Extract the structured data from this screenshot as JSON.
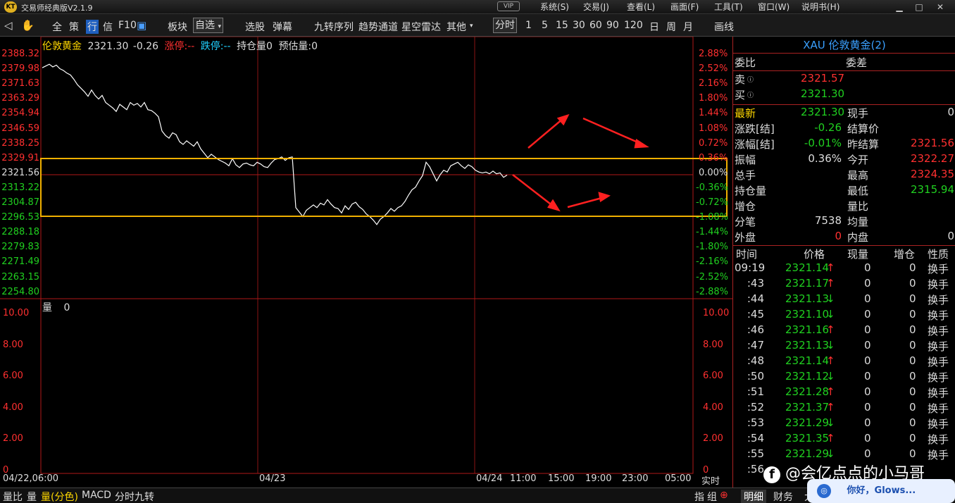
{
  "window": {
    "app_title": "交易师经典版V2.1.9",
    "vip": "VIP",
    "menu": [
      "系统(S)",
      "交易(J)",
      "查看(L)",
      "画面(F)",
      "工具(T)",
      "窗口(W)",
      "说明书(H)"
    ]
  },
  "toolbar": {
    "items": [
      "全",
      "策",
      "行",
      "信",
      "F10",
      "板块",
      "自选",
      "选股",
      "弹幕",
      "九转序列",
      "趋势通道",
      "星空雷达",
      "其他",
      "分时",
      "1",
      "5",
      "15",
      "30",
      "60",
      "90",
      "120",
      "日",
      "周",
      "月",
      "画线"
    ]
  },
  "chart_header": {
    "name": "伦敦黄金",
    "price": "2321.30",
    "change": "-0.26",
    "limit_up": "涨停:--",
    "limit_down": "跌停:--",
    "open_interest": "持仓量0",
    "est_volume": "预估量:0"
  },
  "price_axis": [
    "2388.32",
    "2379.98",
    "2371.63",
    "2363.29",
    "2354.94",
    "2346.59",
    "2338.25",
    "2329.91",
    "2321.56",
    "2313.22",
    "2304.87",
    "2296.53",
    "2288.18",
    "2279.83",
    "2271.49",
    "2263.15",
    "2254.80"
  ],
  "pct_axis": [
    "2.88%",
    "2.52%",
    "2.16%",
    "1.80%",
    "1.44%",
    "1.08%",
    "0.72%",
    "0.36%",
    "0.00%",
    "-0.36%",
    "-0.72%",
    "-1.08%",
    "-1.44%",
    "-1.80%",
    "-2.16%",
    "-2.52%",
    "-2.88%"
  ],
  "vol_header": {
    "label": "量",
    "value": "0"
  },
  "vol_axis": [
    "10.00",
    "8.00",
    "6.00",
    "4.00",
    "2.00",
    "0"
  ],
  "time_axis": {
    "labels": [
      "04/22,06:00",
      "04/23",
      "04/24",
      "11:00",
      "15:00",
      "19:00",
      "23:00",
      "05:00"
    ],
    "realtime": "实时"
  },
  "chart_data": {
    "type": "line",
    "ylim": [
      2254.8,
      2388.32
    ],
    "reference_price": 2321.56,
    "x": [
      0,
      5,
      10,
      15,
      20,
      25,
      30,
      35,
      40,
      45,
      50,
      55,
      60,
      65,
      70,
      75,
      80,
      85,
      90,
      95,
      100,
      105,
      110,
      115,
      120,
      125,
      130,
      135,
      140,
      145,
      150,
      155,
      160,
      165,
      170,
      175,
      180,
      185,
      190,
      195,
      200,
      205,
      210,
      215,
      220,
      225,
      230,
      235,
      240,
      245,
      250,
      255,
      260,
      265,
      270,
      275,
      280,
      285,
      290,
      295,
      300,
      305,
      310,
      315,
      320,
      325,
      330,
      335,
      340,
      345,
      350,
      355,
      360,
      365,
      370,
      375,
      380,
      385,
      390,
      395,
      400,
      405,
      410,
      415,
      420,
      425,
      430,
      435,
      440,
      445,
      450,
      455,
      460,
      465,
      470,
      475,
      480,
      485,
      490,
      495,
      500,
      505,
      510,
      515,
      520,
      525,
      530,
      535,
      540,
      545,
      550,
      555,
      560,
      565,
      570,
      575,
      580,
      585,
      590,
      595,
      600,
      605,
      610,
      615,
      620,
      625,
      630,
      635,
      640,
      645,
      650,
      655,
      660
    ],
    "y": [
      2381.5,
      2382.5,
      2383.5,
      2382.0,
      2383.0,
      2381.0,
      2380.0,
      2378.5,
      2377.5,
      2375.0,
      2372.0,
      2370.0,
      2368.0,
      2365.5,
      2369.0,
      2366.0,
      2364.0,
      2366.0,
      2362.0,
      2360.5,
      2359.0,
      2357.0,
      2361.0,
      2359.5,
      2358.0,
      2362.0,
      2360.5,
      2361.5,
      2359.5,
      2362.0,
      2358.0,
      2357.5,
      2356.0,
      2354.0,
      2346.0,
      2343.5,
      2342.0,
      2345.0,
      2344.0,
      2340.0,
      2338.5,
      2340.5,
      2339.0,
      2337.5,
      2340.0,
      2336.0,
      2333.5,
      2331.0,
      2333.0,
      2331.5,
      2330.0,
      2329.0,
      2328.0,
      2326.5,
      2330.5,
      2327.0,
      2325.5,
      2327.5,
      2328.0,
      2327.0,
      2326.5,
      2328.5,
      2327.5,
      2326.0,
      2325.5,
      2328.0,
      2330.0,
      2330.5,
      2331.5,
      2329.5,
      2331.0,
      2331.5,
      2303.0,
      2300.5,
      2298.0,
      2301.5,
      2303.0,
      2304.5,
      2303.0,
      2305.5,
      2304.5,
      2307.5,
      2305.0,
      2303.0,
      2302.5,
      2300.0,
      2304.0,
      2302.0,
      2305.0,
      2306.0,
      2303.5,
      2302.0,
      2299.5,
      2298.0,
      2296.0,
      2293.5,
      2296.5,
      2298.0,
      2300.0,
      2302.5,
      2301.0,
      2303.0,
      2304.0,
      2306.5,
      2310.0,
      2313.0,
      2314.5,
      2318.0,
      2321.0,
      2328.5,
      2326.0,
      2322.0,
      2318.0,
      2321.5,
      2324.0,
      2323.0,
      2326.5,
      2327.5,
      2328.5,
      2326.5,
      2325.0,
      2327.0,
      2326.0,
      2324.0,
      2323.0,
      2322.5,
      2323.0,
      2322.0,
      2323.5,
      2322.0,
      2322.5,
      2320.0,
      2321.3
    ]
  },
  "right_panel": {
    "title": "XAU 伦敦黄金(2)",
    "weibi_label": "委比",
    "weicha_label": "委差",
    "sell_label": "卖",
    "sell_price": "2321.57",
    "buy_label": "买",
    "buy_price": "2321.30",
    "rows": [
      {
        "l1": "最新",
        "v1": "2321.30",
        "l2": "现手",
        "v2": "0"
      },
      {
        "l1": "涨跌[结]",
        "v1": "-0.26",
        "l2": "结算价",
        "v2": ""
      },
      {
        "l1": "涨幅[结]",
        "v1": "-0.01%",
        "l2": "昨结算",
        "v2": "2321.56"
      },
      {
        "l1": "振幅",
        "v1": "0.36%",
        "l2": "今开",
        "v2": "2322.27"
      },
      {
        "l1": "总手",
        "v1": "",
        "l2": "最高",
        "v2": "2324.35"
      },
      {
        "l1": "持仓量",
        "v1": "",
        "l2": "最低",
        "v2": "2315.94"
      },
      {
        "l1": "增仓",
        "v1": "",
        "l2": "量比",
        "v2": ""
      },
      {
        "l1": "分笔",
        "v1": "7538",
        "l2": "均量",
        "v2": ""
      },
      {
        "l1": "外盘",
        "v1": "0",
        "l2": "内盘",
        "v2": "0"
      }
    ],
    "tick_headers": [
      "时间",
      "价格",
      "现量",
      "增仓",
      "性质"
    ],
    "ticks": [
      {
        "t": "09:19",
        "p": "2321.14",
        "d": "↑",
        "v": "0",
        "z": "0",
        "k": "换手"
      },
      {
        "t": ":43",
        "p": "2321.17",
        "d": "↑",
        "v": "0",
        "z": "0",
        "k": "换手"
      },
      {
        "t": ":44",
        "p": "2321.13",
        "d": "↓",
        "v": "0",
        "z": "0",
        "k": "换手"
      },
      {
        "t": ":45",
        "p": "2321.10",
        "d": "↓",
        "v": "0",
        "z": "0",
        "k": "换手"
      },
      {
        "t": ":46",
        "p": "2321.16",
        "d": "↑",
        "v": "0",
        "z": "0",
        "k": "换手"
      },
      {
        "t": ":47",
        "p": "2321.13",
        "d": "↓",
        "v": "0",
        "z": "0",
        "k": "换手"
      },
      {
        "t": ":48",
        "p": "2321.14",
        "d": "↑",
        "v": "0",
        "z": "0",
        "k": "换手"
      },
      {
        "t": ":50",
        "p": "2321.12",
        "d": "↓",
        "v": "0",
        "z": "0",
        "k": "换手"
      },
      {
        "t": ":51",
        "p": "2321.28",
        "d": "↑",
        "v": "0",
        "z": "0",
        "k": "换手"
      },
      {
        "t": ":52",
        "p": "2321.37",
        "d": "↑",
        "v": "0",
        "z": "0",
        "k": "换手"
      },
      {
        "t": ":53",
        "p": "2321.29",
        "d": "↓",
        "v": "0",
        "z": "0",
        "k": "换手"
      },
      {
        "t": ":54",
        "p": "2321.35",
        "d": "↑",
        "v": "0",
        "z": "0",
        "k": "换手"
      },
      {
        "t": ":55",
        "p": "2321.29",
        "d": "↓",
        "v": "0",
        "z": "0",
        "k": "换手"
      },
      {
        "t": ":56",
        "p": "",
        "d": "",
        "v": "",
        "z": "",
        "k": ""
      }
    ]
  },
  "bottom_tabs": [
    "量比",
    "量",
    "量(分色)",
    "MACD",
    "分时九转"
  ],
  "bottom_right": [
    "指",
    "组",
    "明细",
    "财务",
    "大单"
  ],
  "watermark": "@会亿点点的小马哥",
  "notification": "你好，Glows...",
  "colors": {
    "up": "#ff3030",
    "down": "#20d020",
    "yellow": "#ffd800",
    "axis_red": "#b01818",
    "box": "#f0b000"
  }
}
